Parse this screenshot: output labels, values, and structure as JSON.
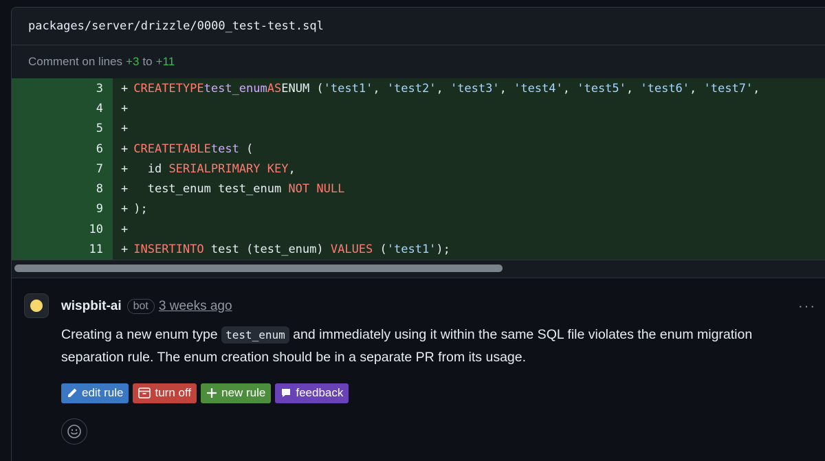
{
  "file": {
    "path": "packages/server/drizzle/0000_test-test.sql"
  },
  "comment_range": {
    "prefix": "Comment on lines",
    "start": "+3",
    "middle": "to",
    "end": "+11"
  },
  "code_lines": [
    {
      "num": "3"
    },
    {
      "num": "4"
    },
    {
      "num": "5"
    },
    {
      "num": "6"
    },
    {
      "num": "7"
    },
    {
      "num": "8"
    },
    {
      "num": "9"
    },
    {
      "num": "10"
    },
    {
      "num": "11"
    }
  ],
  "code_text": {
    "plus": "+",
    "create": "CREATE",
    "type": "TYPE",
    "test_enum": "test_enum",
    "as": "AS",
    "enum": "ENUM",
    "open_paren": " (",
    "s1": "'test1'",
    "s2": "'test2'",
    "s3": "'test3'",
    "s4": "'test4'",
    "s5": "'test5'",
    "s6": "'test6'",
    "s7": "'test7'",
    "comma": ", ",
    "table": "TABLE",
    "test": "test",
    "paren_open": " (",
    "id": "  id ",
    "serial": "SERIAL",
    "primary_key": "PRIMARY KEY",
    "comma_end": ",",
    "col_def": "  test_enum test_enum ",
    "not_null": "NOT NULL",
    "close": ");",
    "insert": "INSERT",
    "into": "INTO",
    "test_cols": " test (test_enum) ",
    "values": "VALUES",
    "val_open": " (",
    "val_str": "'test1'",
    "val_close": ");"
  },
  "comment": {
    "author": "wispbit-ai",
    "badge": "bot",
    "time": "3 weeks ago",
    "more": "···",
    "body_pre": "Creating a new enum type ",
    "body_code": "test_enum",
    "body_post": " and immediately using it within the same SQL file violates the enum migration separation rule. The enum creation should be in a separate PR from its usage."
  },
  "actions": {
    "edit": "edit rule",
    "off": "turn off",
    "new": "new rule",
    "feedback": "feedback"
  },
  "colors": {
    "keyword": "#ff7b72",
    "type": "#d2a8ff",
    "string": "#a5d6ff",
    "added_bg": "#1f4f2c",
    "accent_green": "#3fb950"
  }
}
